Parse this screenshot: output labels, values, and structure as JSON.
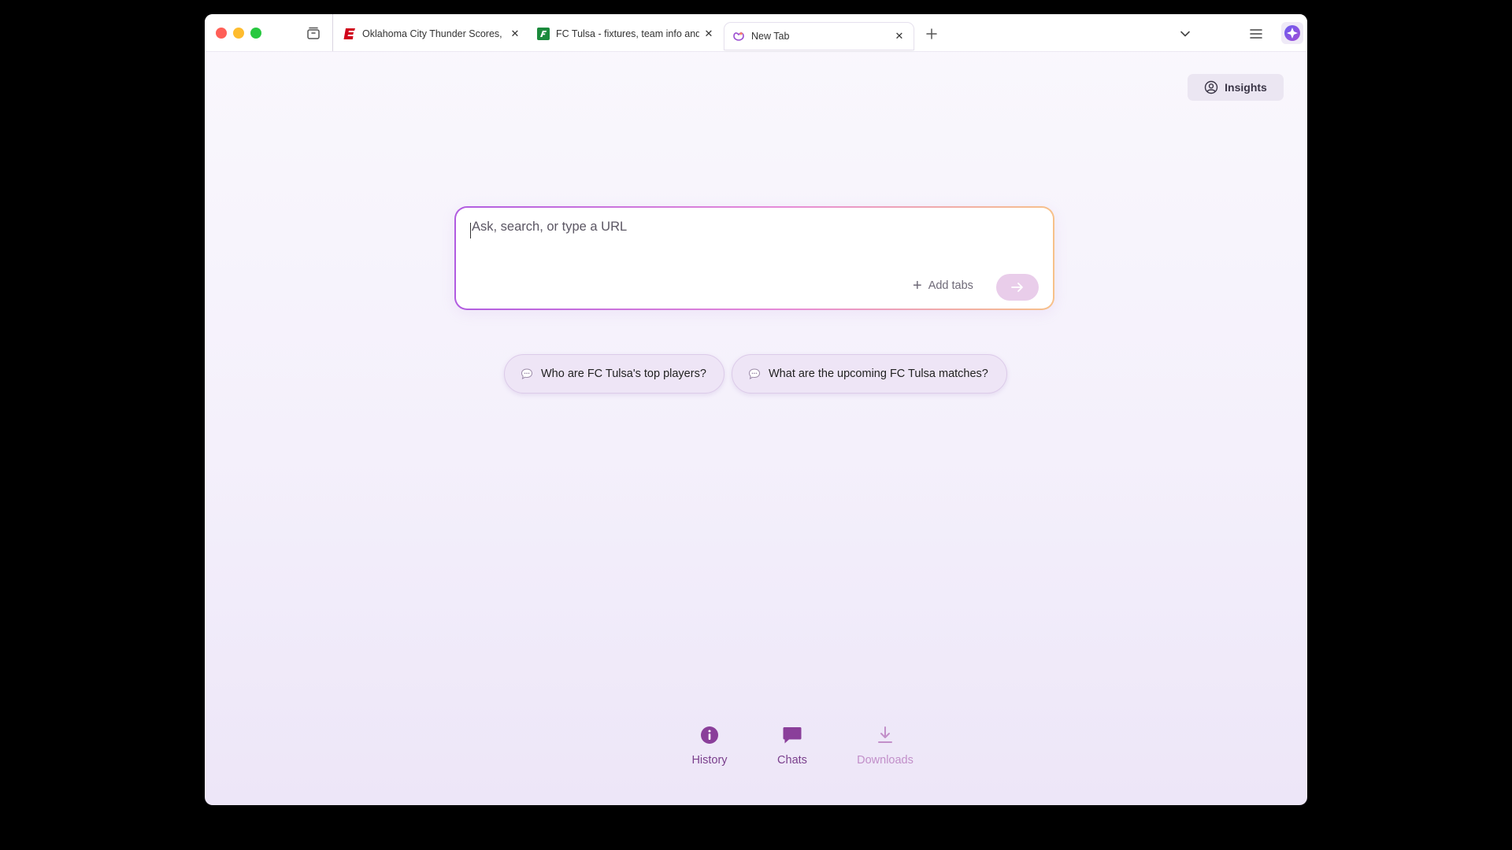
{
  "browser": {
    "tabs": [
      {
        "title": "Oklahoma City Thunder Scores, Stats and Highlights - ESPN",
        "favicon": "espn-icon",
        "active": false
      },
      {
        "title": "FC Tulsa - fixtures, team info and results",
        "favicon": "fotmob-icon",
        "active": false
      },
      {
        "title": "New Tab",
        "favicon": "new-tab-sparkle-icon",
        "active": true
      }
    ],
    "colors": {
      "accent": "#8a3f9a",
      "search_border_start": "#b15ce0",
      "search_border_end": "#f7c18a"
    }
  },
  "header": {
    "insights_label": "Insights"
  },
  "search": {
    "placeholder": "Ask, search, or type a URL",
    "add_tabs_label": "Add tabs"
  },
  "suggestions": [
    {
      "text": "Who are FC Tulsa's top players?"
    },
    {
      "text": "What are the upcoming FC Tulsa matches?"
    }
  ],
  "bottom_nav": [
    {
      "label": "History",
      "icon": "info-icon"
    },
    {
      "label": "Chats",
      "icon": "chat-icon"
    },
    {
      "label": "Downloads",
      "icon": "download-icon"
    }
  ]
}
